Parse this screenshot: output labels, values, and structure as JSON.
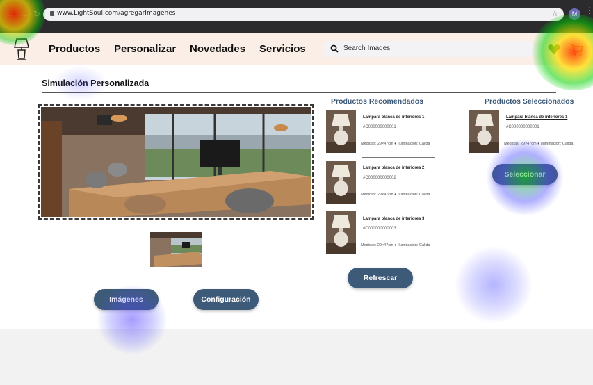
{
  "browser": {
    "url": "www.LightSoul.com/agregarImagenes",
    "profile_initial": "M"
  },
  "header": {
    "nav": [
      "Productos",
      "Personalizar",
      "Novedades",
      "Servicios"
    ],
    "search_placeholder": "Search Images"
  },
  "main": {
    "title": "Simulación Personalizada",
    "buttons": {
      "images": "Imágenes",
      "config": "Configuración",
      "refresh": "Refrescar",
      "select": "Seleccionar"
    }
  },
  "recommended": {
    "title": "Productos Recomendados",
    "items": [
      {
        "name": "Lampara blanca de interiores 1",
        "code": "#C000000000001",
        "meta": "Medidas: 29×47cm ● Iluminación: Cálida"
      },
      {
        "name": "Lampara blanca de interiores 2",
        "code": "#C000000000002",
        "meta": "Medidas: 29×47cm ● Iluminación: Cálida"
      },
      {
        "name": "Lampara blanca de interiores 3",
        "code": "#C000000000003",
        "meta": "Medidas: 29×47cm ● Iluminación: Cálida"
      }
    ]
  },
  "selected": {
    "title": "Productos Seleccionados",
    "item": {
      "name": "Lampara blanca de interiores 1",
      "code": "#C000000000001",
      "meta": "Medidas: 29×47cm ● Iluminación: Cálida"
    }
  },
  "colors": {
    "accent": "#3d5a78",
    "header_bg": "#fbeee6",
    "heart": "#2f8a2f",
    "cart": "#e05a1a"
  }
}
